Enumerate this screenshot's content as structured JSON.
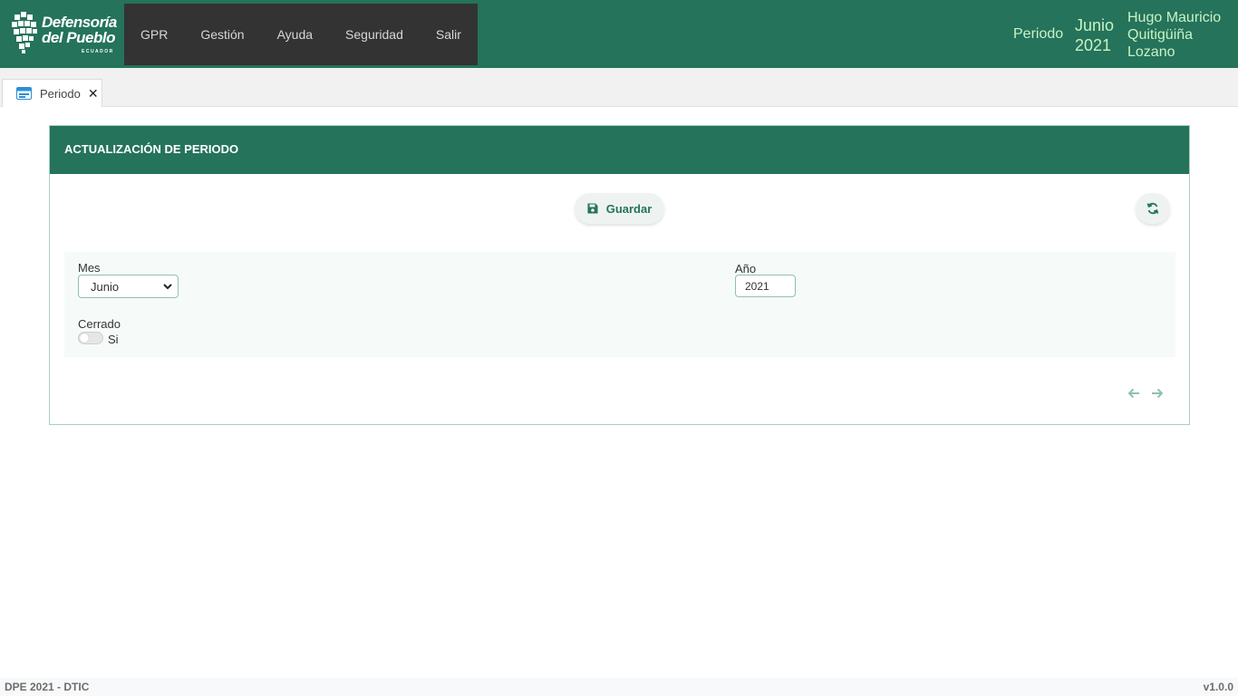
{
  "brand": {
    "logo_line1": "Defensoría",
    "logo_line2": "del Pueblo",
    "logo_sub": "ECUADOR"
  },
  "nav": {
    "items": [
      {
        "label": "GPR"
      },
      {
        "label": "Gestión"
      },
      {
        "label": "Ayuda"
      },
      {
        "label": "Seguridad"
      },
      {
        "label": "Salir"
      }
    ]
  },
  "header": {
    "periodo_label": "Periodo",
    "month": "Junio",
    "year": "2021",
    "user_line1": "Hugo Mauricio",
    "user_line2": "Quitigüiña",
    "user_line3": "Lozano"
  },
  "tabs": [
    {
      "label": "Periodo",
      "icon": "calendar-icon",
      "close": "✕"
    }
  ],
  "card": {
    "title": "ACTUALIZACIÓN DE PERIODO",
    "save_label": "Guardar",
    "form": {
      "mes_label": "Mes",
      "mes_value": "Junio",
      "anio_label": "Año",
      "anio_value": "2021",
      "cerrado_label": "Cerrado",
      "cerrado_option": "Si",
      "cerrado_on": false
    }
  },
  "footer": {
    "left": "DPE 2021 - DTIC",
    "right": "v1.0.0"
  },
  "colors": {
    "primary": "#24735a",
    "navbar": "#333333",
    "header_text": "#c9f2c5"
  }
}
